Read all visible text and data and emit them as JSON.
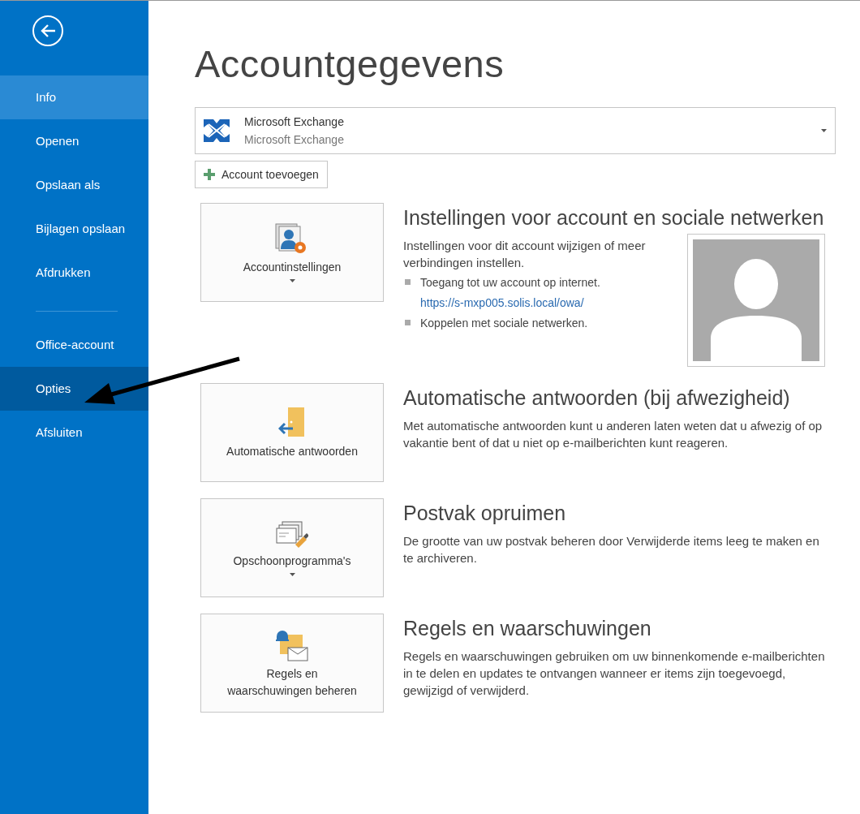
{
  "sidebar": {
    "items": [
      {
        "label": "Info",
        "selected": true,
        "hovered": false
      },
      {
        "label": "Openen",
        "selected": false,
        "hovered": false
      },
      {
        "label": "Opslaan als",
        "selected": false,
        "hovered": false
      },
      {
        "label": "Bijlagen opslaan",
        "selected": false,
        "hovered": false
      },
      {
        "label": "Afdrukken",
        "selected": false,
        "hovered": false
      },
      {
        "kind": "divider"
      },
      {
        "label": "Office-account",
        "selected": false,
        "hovered": false
      },
      {
        "label": "Opties",
        "selected": false,
        "hovered": true
      },
      {
        "label": "Afsluiten",
        "selected": false,
        "hovered": false
      }
    ]
  },
  "page_title": "Accountgegevens",
  "account": {
    "name": "Microsoft Exchange",
    "type": "Microsoft Exchange"
  },
  "add_account_button": "Account toevoegen",
  "sections": [
    {
      "button": {
        "label": "Accountinstellingen",
        "dropdown": true
      },
      "title": "Instellingen voor account en sociale netwerken",
      "description": "Instellingen voor dit account wijzigen of meer verbindingen instellen.",
      "bullets": [
        {
          "text": "Toegang tot uw account op internet.",
          "link": "https://s-mxp005.solis.local/owa/"
        },
        {
          "text": "Koppelen met sociale netwerken."
        }
      ],
      "avatar": true
    },
    {
      "button": {
        "label": "Automatische antwoorden",
        "dropdown": false
      },
      "title": "Automatische antwoorden (bij afwezigheid)",
      "description": "Met automatische antwoorden kunt u anderen laten weten dat u afwezig of op vakantie bent of dat u niet op e-mailberichten kunt reageren."
    },
    {
      "button": {
        "label": "Opschoonprogramma's",
        "dropdown": true
      },
      "title": "Postvak opruimen",
      "description": "De grootte van uw postvak beheren door Verwijderde items leeg te maken en te archiveren."
    },
    {
      "button": {
        "label": "Regels en waarschuwingen beheren",
        "dropdown": false
      },
      "title": "Regels en waarschuwingen",
      "description": "Regels en waarschuwingen gebruiken om uw binnenkomende e-mailberichten in te delen en updates te ontvangen wanneer er items zijn toegevoegd, gewijzigd of verwijderd."
    }
  ]
}
